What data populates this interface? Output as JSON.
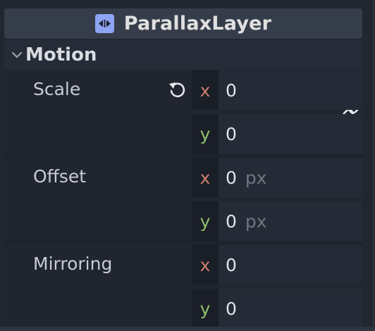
{
  "inspector": {
    "node_type_label": "ParallaxLayer",
    "node_icon": "parallax-layer-icon",
    "accent_color": "#8da5f3"
  },
  "section": {
    "title": "Motion",
    "expanded": true,
    "chevron_icon": "chevron-down-icon"
  },
  "properties": {
    "scale": {
      "label": "Scale",
      "x": "0",
      "y": "0",
      "revert_icon": "revert-icon",
      "link_icon": "link-icon"
    },
    "offset": {
      "label": "Offset",
      "x": "0",
      "y": "0",
      "unit": "px"
    },
    "mirroring": {
      "label": "Mirroring",
      "x": "0",
      "y": "0"
    }
  },
  "axis_labels": {
    "x": "x",
    "y": "y"
  },
  "colors": {
    "axis_x": "#c97d6e",
    "axis_y": "#8fbf6f"
  }
}
